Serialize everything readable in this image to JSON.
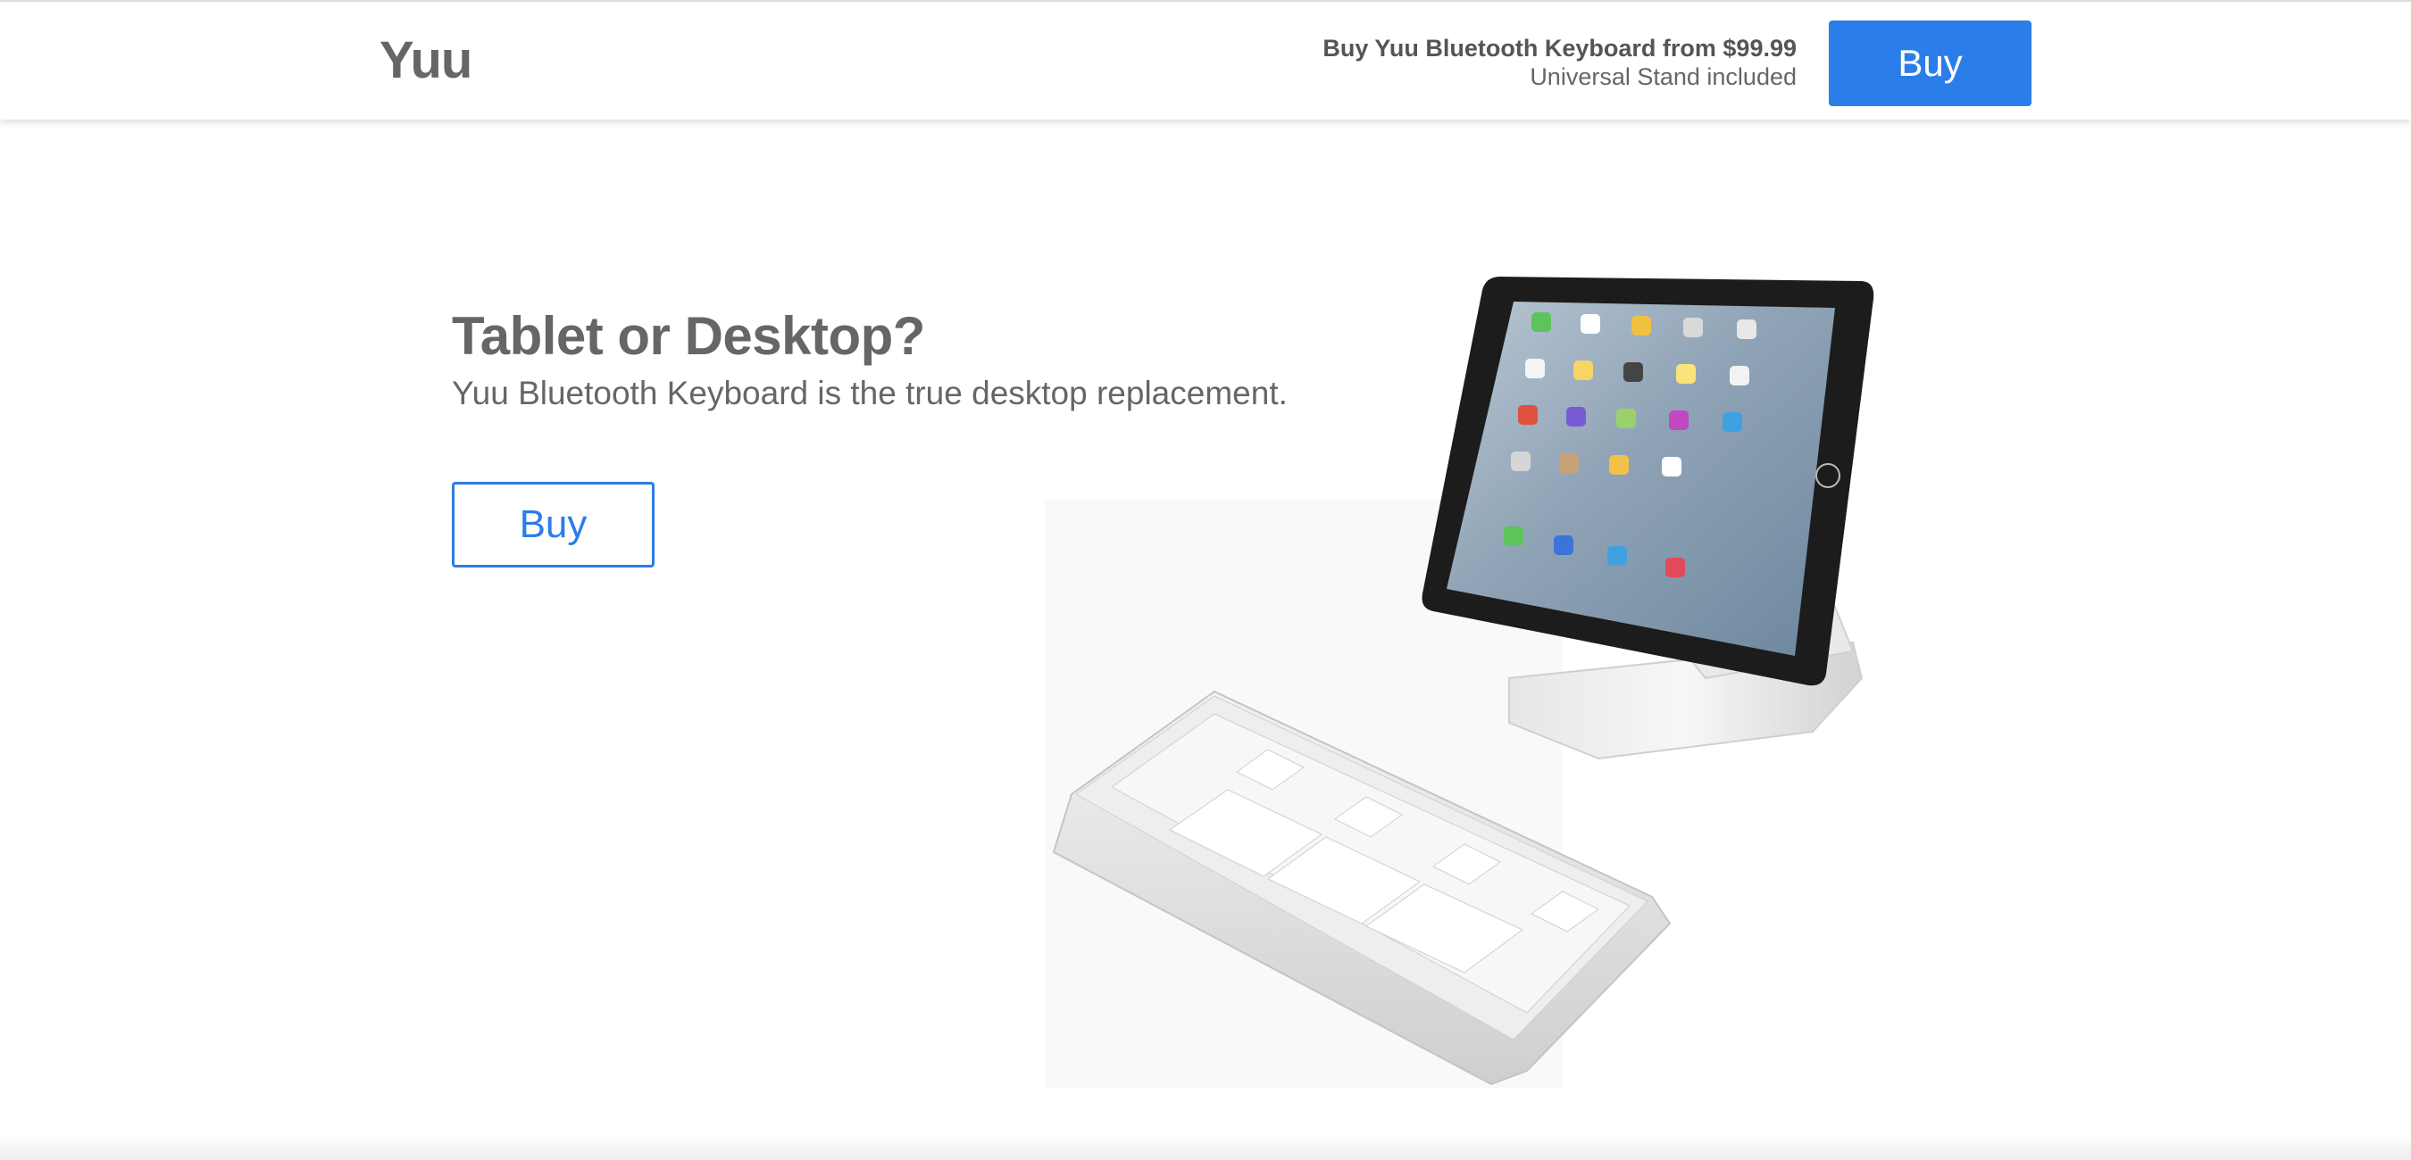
{
  "header": {
    "brand": "Yuu",
    "offer_title": "Buy Yuu Bluetooth Keyboard from $99.99",
    "offer_subtitle": "Universal Stand included",
    "buy_label": "Buy"
  },
  "hero": {
    "title": "Tablet or Desktop?",
    "subtitle": "Yuu Bluetooth Keyboard is the true desktop replacement.",
    "buy_label": "Buy"
  },
  "colors": {
    "accent": "#2b7de9",
    "text": "#666666"
  },
  "images": {
    "product": "tablet-on-stand-with-keyboard"
  }
}
